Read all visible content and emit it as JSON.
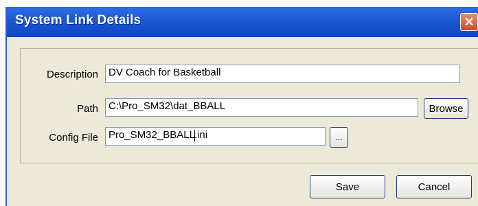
{
  "window": {
    "title": "System Link Details",
    "close_glyph": "✕"
  },
  "form": {
    "description": {
      "label": "Description",
      "value": "DV Coach for Basketball"
    },
    "path": {
      "label": "Path",
      "value": "C:\\Pro_SM32\\dat_BBALL"
    },
    "config_file": {
      "label": "Config File",
      "value_before_caret": "Pro_SM32_BBALL",
      "value_after_caret": ".ini"
    }
  },
  "buttons": {
    "browse": "Browse",
    "ellipsis": "...",
    "save": "Save",
    "cancel": "Cancel"
  },
  "colors": {
    "title_bar": "#1b57d2",
    "dialog_bg": "#ece9d8",
    "close_button": "#c94a2c"
  }
}
